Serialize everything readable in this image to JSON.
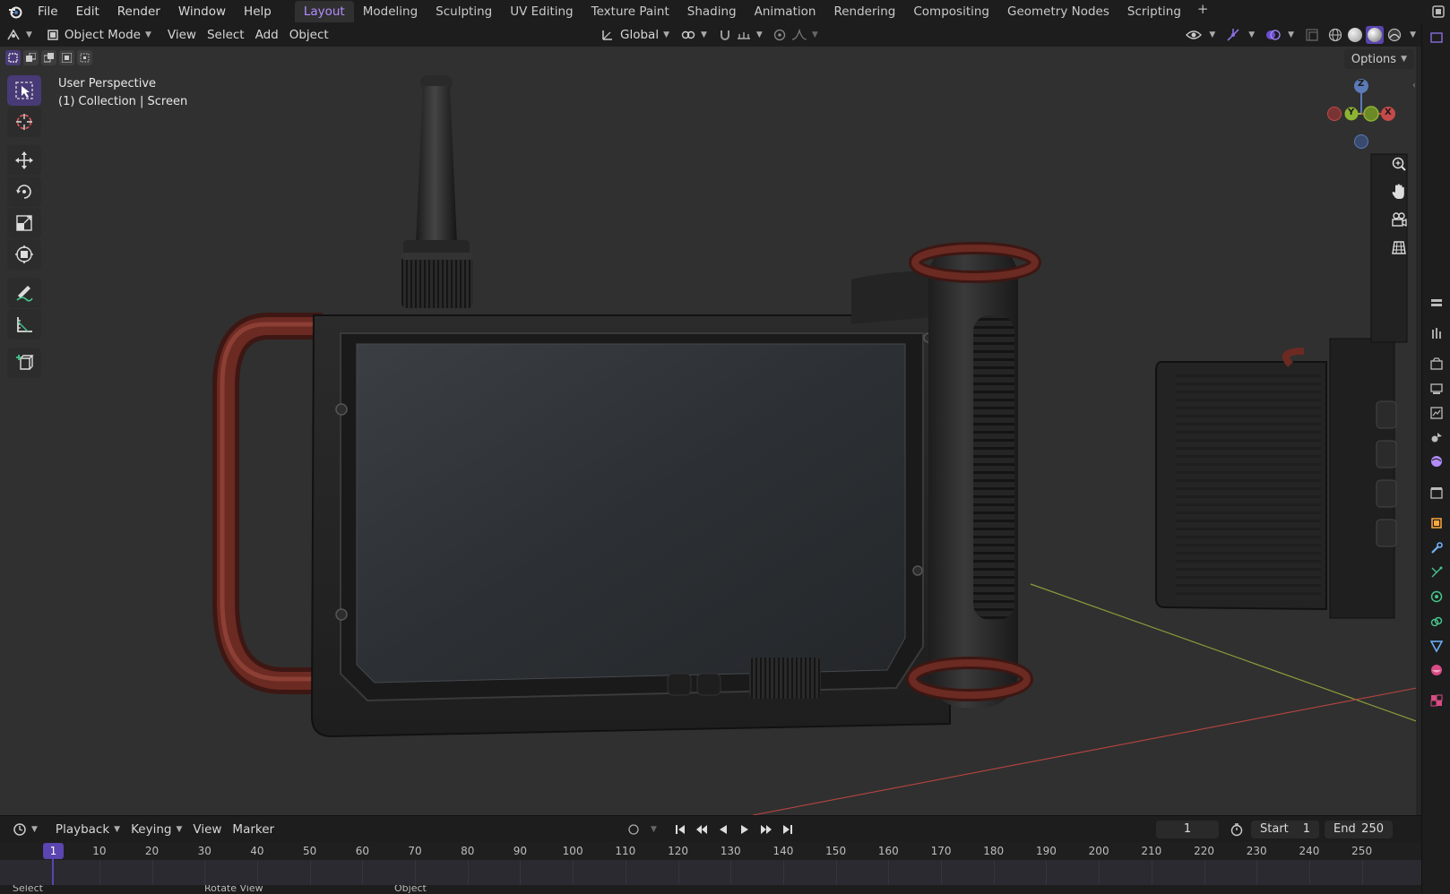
{
  "menubar": {
    "items": [
      "File",
      "Edit",
      "Render",
      "Window",
      "Help"
    ],
    "workspaces": [
      {
        "label": "Layout",
        "active": true
      },
      {
        "label": "Modeling",
        "active": false
      },
      {
        "label": "Sculpting",
        "active": false
      },
      {
        "label": "UV Editing",
        "active": false
      },
      {
        "label": "Texture Paint",
        "active": false
      },
      {
        "label": "Shading",
        "active": false
      },
      {
        "label": "Animation",
        "active": false
      },
      {
        "label": "Rendering",
        "active": false
      },
      {
        "label": "Compositing",
        "active": false
      },
      {
        "label": "Geometry Nodes",
        "active": false
      },
      {
        "label": "Scripting",
        "active": false
      }
    ],
    "add_workspace": "+"
  },
  "header": {
    "mode": "Object Mode",
    "menus": [
      "View",
      "Select",
      "Add",
      "Object"
    ],
    "transform_orientation": "Global"
  },
  "viewport": {
    "options_label": "Options",
    "overlay_line1": "User Perspective",
    "overlay_line2": "(1) Collection | Screen",
    "gizmo": {
      "x": "X",
      "y": "Y",
      "z": "Z"
    }
  },
  "timeline": {
    "menus": [
      "Playback",
      "Keying",
      "View",
      "Marker"
    ],
    "current_frame": "1",
    "start_label": "Start",
    "start_value": "1",
    "end_label": "End",
    "end_value": "250",
    "playhead_frame": "1",
    "ticks": [
      "10",
      "20",
      "30",
      "40",
      "50",
      "60",
      "70",
      "80",
      "90",
      "100",
      "110",
      "120",
      "130",
      "140",
      "150",
      "160",
      "170",
      "180",
      "190",
      "200",
      "210",
      "220",
      "230",
      "240",
      "250"
    ]
  },
  "statusbar": {
    "items": [
      "Select",
      "Rotate View",
      "Object"
    ]
  },
  "colors": {
    "accent": "#b48cff",
    "active_tool": "#473a76",
    "playhead": "#5b45b0",
    "viewport_bg": "#303030",
    "handle_red": "#6b2a22"
  },
  "icons": {
    "tools": [
      "select-box-icon",
      "cursor-icon",
      "move-icon",
      "rotate-icon",
      "scale-icon",
      "transform-icon",
      "annotate-icon",
      "measure-icon",
      "add-cube-icon"
    ],
    "nav": [
      "zoom-icon",
      "pan-hand-icon",
      "camera-icon",
      "ortho-grid-icon"
    ]
  }
}
